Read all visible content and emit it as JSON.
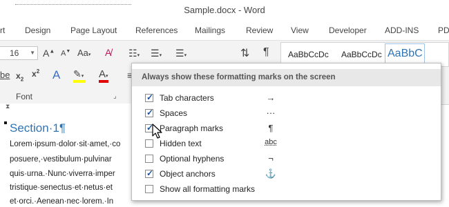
{
  "window": {
    "title": "Sample.docx - Word"
  },
  "tabs": [
    "rt",
    "Design",
    "Page Layout",
    "References",
    "Mailings",
    "Review",
    "View",
    "Developer",
    "ADD-INS",
    "PD"
  ],
  "ribbon": {
    "font_size": "16",
    "font_group_label": "Font",
    "styles": [
      "AaBbCcDc",
      "AaBbCcDc",
      "AaBbC"
    ]
  },
  "document": {
    "heading": "Section·1¶",
    "lines": [
      "Lorem·ipsum·dolor·sit·amet,·co",
      "posuere,·vestibulum·pulvinar",
      "quis·urna.·Nunc·viverra·imper",
      "tristique·senectus·et·netus·et",
      "et·orci.·Aenean·nec·lorem.·In"
    ]
  },
  "panel": {
    "title": "Always show these formatting marks on the screen",
    "options": [
      {
        "label": "Tab characters",
        "checked": true,
        "symbol": "→"
      },
      {
        "label": "Spaces",
        "checked": true,
        "symbol": "···"
      },
      {
        "label": "Paragraph marks",
        "checked": true,
        "symbol": "¶"
      },
      {
        "label": "Hidden text",
        "checked": false,
        "symbol": "abc"
      },
      {
        "label": "Optional hyphens",
        "checked": false,
        "symbol": "¬"
      },
      {
        "label": "Object anchors",
        "checked": true,
        "symbol": "⚓"
      },
      {
        "label": "Show all formatting marks",
        "checked": false,
        "symbol": ""
      }
    ]
  },
  "colors": {
    "accent": "#2e74b5",
    "heading": "#2e74b5",
    "highlight": "#ffff00",
    "font_color": "#e00000"
  }
}
